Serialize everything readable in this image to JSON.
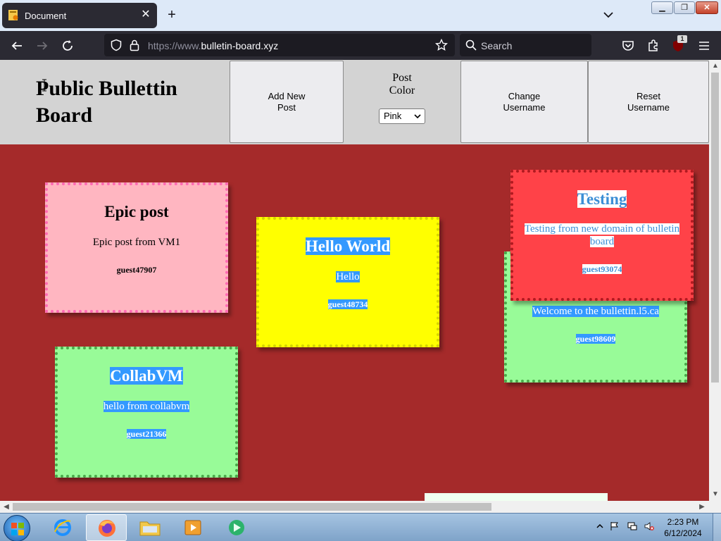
{
  "browser": {
    "tab_title": "Document",
    "url_prefix": "https://www.",
    "url_domain": "bulletin-board.xyz",
    "search_placeholder": "Search",
    "extension_badge": "1"
  },
  "page": {
    "title": "Public Bullettin Board",
    "buttons": {
      "add_post": "Add New Post",
      "change_username": "Change Username",
      "reset_username": "Reset Username"
    },
    "post_color": {
      "label": "Post Color",
      "selected": "Pink"
    }
  },
  "posts": [
    {
      "title": "Epic post",
      "body": "Epic post from VM1",
      "author": "guest47907",
      "color": "#ffb6c1",
      "border": "#ff69b4"
    },
    {
      "title": "Hello World",
      "body": "Hello",
      "author": "guest48734",
      "color": "#ffff00",
      "border": "#d4d400"
    },
    {
      "title": "",
      "body": "Welcome to the bullettin.l5.ca",
      "author": "guest98609",
      "color": "#98fb98",
      "border": "#4aa84a"
    },
    {
      "title": "Testing",
      "body": "Testing from new domain of bulletin board",
      "author": "guest93074",
      "color": "#ff4248",
      "border": "#b01a20"
    },
    {
      "title": "CollabVM",
      "body": "hello from collabvm",
      "author": "guest21366",
      "color": "#98fb98",
      "border": "#4aa84a"
    }
  ],
  "taskbar": {
    "time": "2:23 PM",
    "date": "6/12/2024"
  }
}
